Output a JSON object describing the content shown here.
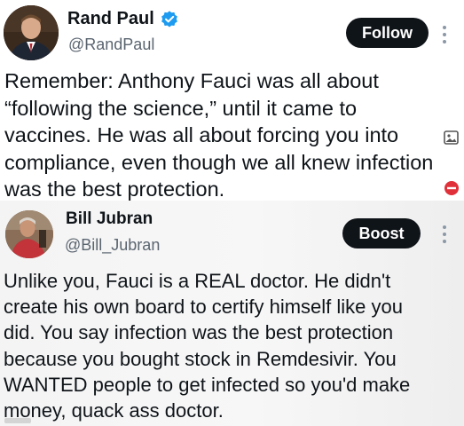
{
  "posts": [
    {
      "author_name": "Rand Paul",
      "handle": "@RandPaul",
      "verified": true,
      "action_label": "Follow",
      "avatar": "portrait-avatar",
      "text": "Remember: Anthony Fauci was all about\n“following the science,” until it came to\nvaccines. He was all about forcing you into\ncompliance, even though we all knew infection\nwas the best protection."
    },
    {
      "author_name": "Bill Jubran",
      "handle": "@Bill_Jubran",
      "verified": false,
      "action_label": "Boost",
      "avatar": "portrait-avatar",
      "text": "Unlike you, Fauci is a REAL doctor. He didn't\ncreate his own board to certify himself like you\ndid. You say infection was the best protection\nbecause you bought stock in Remdesivir. You\nWANTED people to get infected so you'd make\nmoney, quack ass doctor."
    }
  ],
  "icons": {
    "verified": "verified-badge-icon",
    "more": "more-vertical-icon",
    "side_1": "image-icon",
    "side_2": "stop-sign-icon"
  },
  "colors": {
    "text": "#0f1419",
    "secondary": "#5b6570",
    "button_bg": "#0f1419",
    "button_text": "#ffffff",
    "verified": "#1d9bf0"
  }
}
